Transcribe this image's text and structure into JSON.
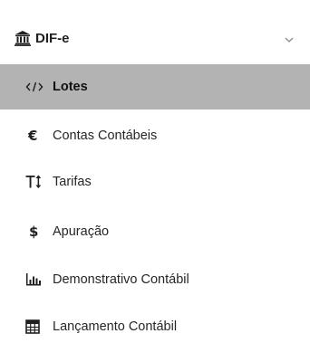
{
  "menu": {
    "group": {
      "label": "DIF-e",
      "icon": "bank-icon",
      "expanded": true
    },
    "items": [
      {
        "label": "Lotes",
        "icon": "code-icon",
        "active": true
      },
      {
        "label": "Contas Contábeis",
        "icon": "euro-icon",
        "active": false
      },
      {
        "label": "Tarifas",
        "icon": "text-height-icon",
        "active": false
      },
      {
        "label": "Apuração",
        "icon": "dollar-icon",
        "active": false
      },
      {
        "label": "Demonstrativo Contábil",
        "icon": "bar-chart-icon",
        "active": false
      },
      {
        "label": "Lançamento Contábil",
        "icon": "calculator-icon",
        "active": false
      }
    ]
  },
  "colors": {
    "active_background": "#b3b3b3",
    "text": "#262626"
  }
}
